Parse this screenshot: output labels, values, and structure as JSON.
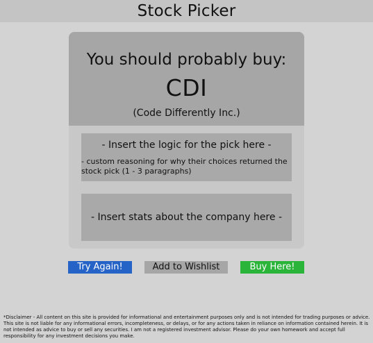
{
  "app": {
    "title": "Stock Picker"
  },
  "pick": {
    "heading": "You should probably buy:",
    "ticker": "CDI",
    "company_name": "(Code Differently Inc.)"
  },
  "logic": {
    "title": "- Insert the logic for the pick here -",
    "body": "- custom reasoning for why their choices returned the stock pick (1 - 3 paragraphs)"
  },
  "stats": {
    "title": "- Insert stats about the company here -"
  },
  "actions": {
    "try_again_label": "Try Again!",
    "wishlist_label": "Add to Wishlist",
    "buy_label": "Buy Here!"
  },
  "disclaimer": {
    "text": "*Disclaimer - All content on this site is provided for informational and entertainment purposes only and is not intended for trading purposes or advice. This site is not liable for any informational errors, incompleteness, or delays, or for any actions taken in reliance on information contained herein.  It is not intended as advice to buy or sell any securities. I am not a registered investment advisor. Please do your own homework and accept full responsibility for any investment decisions you make."
  },
  "colors": {
    "page_background": "#d3d3d3",
    "header_background": "#c4c4c4",
    "card_background": "#c8c8c8",
    "pick_background": "#a6a6a6",
    "panel_background": "#a9a9a9",
    "try_again_button": "#2563c7",
    "wishlist_button": "#a6a6a6",
    "buy_button": "#2ab43a"
  }
}
